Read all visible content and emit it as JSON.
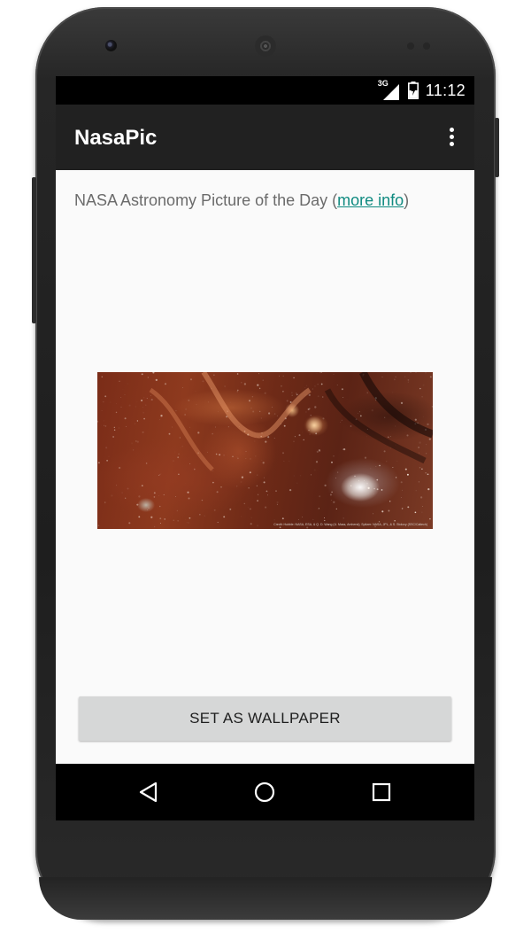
{
  "status_bar": {
    "network_type": "3G",
    "time": "11:12",
    "icons": [
      "signal-icon",
      "battery-charging-icon"
    ]
  },
  "app_bar": {
    "title": "NasaPic",
    "overflow_icon": "overflow-menu-icon"
  },
  "content": {
    "intro_prefix": "NASA Astronomy Picture of the Day (",
    "link_label": "more info",
    "intro_suffix": ")",
    "image_credit": "Credit: Hubble: NASA, ESA, & Q. D. Wang (U. Mass, Amherst); Spitzer: NASA, JPL, & S. Stolovy (SSC/Caltech)",
    "wallpaper_button_label": "SET AS WALLPAPER"
  },
  "nav_bar": {
    "buttons": [
      "back-icon",
      "home-icon",
      "recents-icon"
    ]
  },
  "colors": {
    "app_bar": "#212121",
    "status_bar": "#000000",
    "link": "#0f8a80",
    "background": "#fafafa",
    "button": "#d6d7d7"
  }
}
